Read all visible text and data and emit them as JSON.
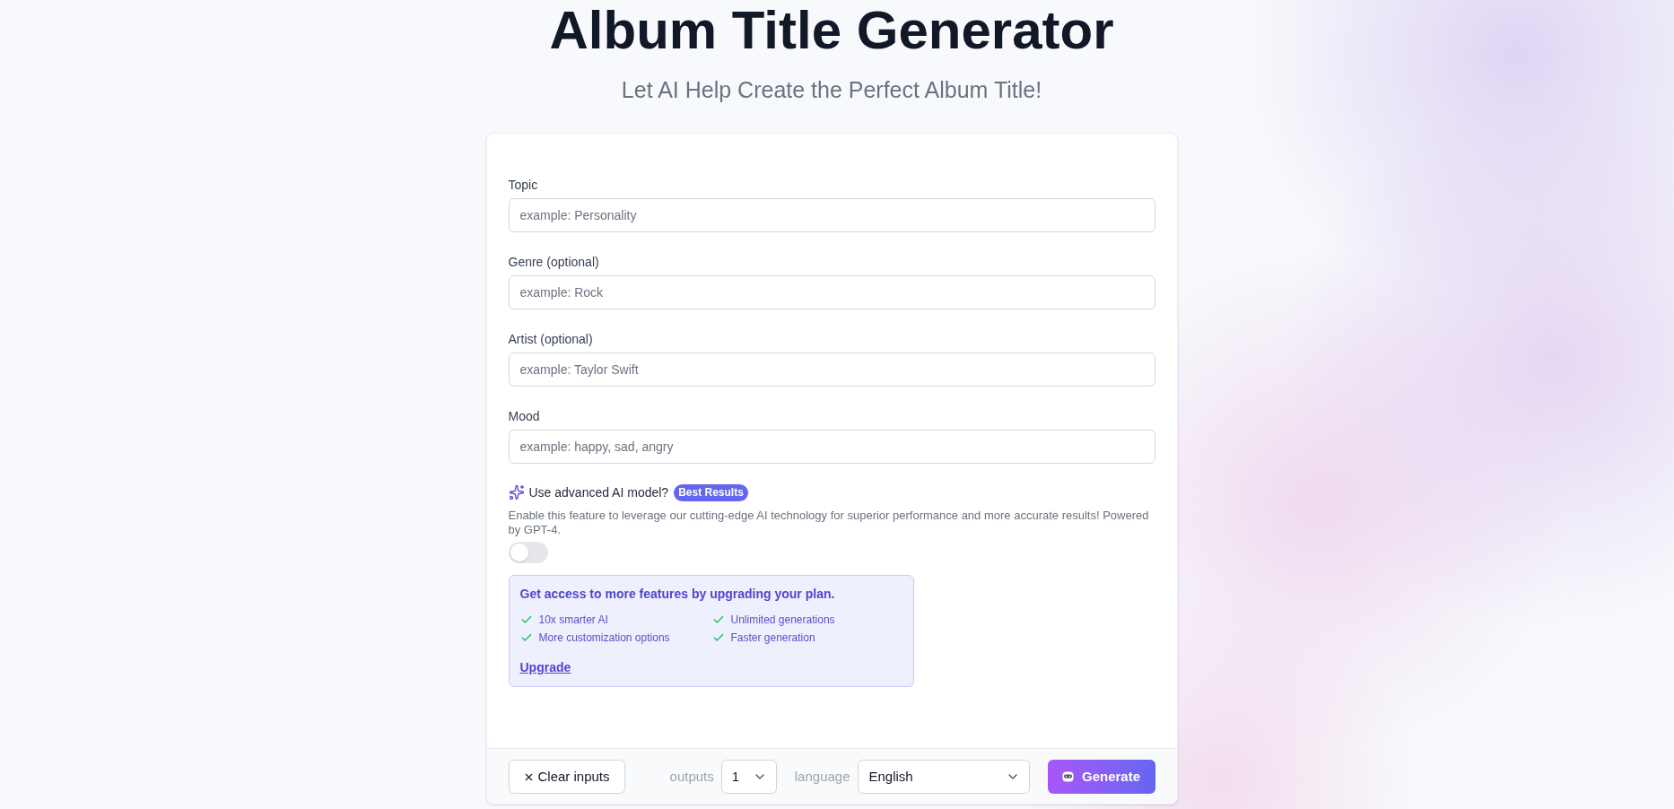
{
  "header": {
    "title": "Album Title Generator",
    "subtitle": "Let AI Help Create the Perfect Album Title!"
  },
  "form": {
    "fields": [
      {
        "label": "Topic",
        "placeholder": "example: Personality"
      },
      {
        "label": "Genre (optional)",
        "placeholder": "example: Rock"
      },
      {
        "label": "Artist (optional)",
        "placeholder": "example: Taylor Swift"
      },
      {
        "label": "Mood",
        "placeholder": "example: happy, sad, angry"
      }
    ],
    "advanced": {
      "label": "Use advanced AI model?",
      "badge": "Best Results",
      "description": "Enable this feature to leverage our cutting-edge AI technology for superior performance and more accurate results! Powered by GPT-4.",
      "on": false
    },
    "upgrade": {
      "title": "Get access to more features by upgrading your plan.",
      "features": [
        "10x smarter AI",
        "Unlimited generations",
        "More customization options",
        "Faster generation"
      ],
      "link": "Upgrade"
    }
  },
  "footer": {
    "clear_button": "Clear inputs",
    "outputs": {
      "label": "outputs",
      "value": "1"
    },
    "language": {
      "label": "language",
      "value": "English"
    },
    "generate_button": "Generate"
  }
}
